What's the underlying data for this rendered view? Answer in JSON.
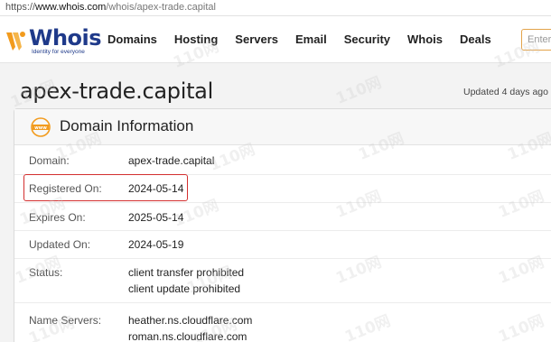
{
  "url_bar": {
    "scheme": "https://",
    "host": "www.whois.com",
    "path": "/whois/apex-trade.capital"
  },
  "logo": {
    "word": "Whois",
    "tagline": "Identity for everyone"
  },
  "nav": {
    "items": [
      "Domains",
      "Hosting",
      "Servers",
      "Email",
      "Security",
      "Whois",
      "Deals"
    ],
    "search_placeholder": "Enter"
  },
  "page": {
    "title": "apex-trade.capital",
    "updated": "Updated 4 days ago"
  },
  "domain_info": {
    "heading": "Domain Information",
    "rows": [
      {
        "label": "Domain:",
        "values": [
          "apex-trade.capital"
        ]
      },
      {
        "label": "Registered On:",
        "values": [
          "2024-05-14"
        ]
      },
      {
        "label": "Expires On:",
        "values": [
          "2025-05-14"
        ]
      },
      {
        "label": "Updated On:",
        "values": [
          "2024-05-19"
        ]
      },
      {
        "label": "Status:",
        "values": [
          "client transfer prohibited",
          "client update prohibited"
        ]
      },
      {
        "label": "Name Servers:",
        "values": [
          "heather.ns.cloudflare.com",
          "roman.ns.cloudflare.com"
        ]
      }
    ]
  },
  "watermark": "110网",
  "colors": {
    "brand": "#1f3a8a",
    "accent": "#f29b1d",
    "highlight": "#d32f2f"
  }
}
